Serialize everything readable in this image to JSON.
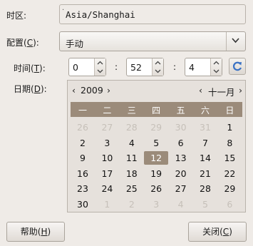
{
  "timezone": {
    "label": "时区:",
    "value": "Asia/Shanghai"
  },
  "config": {
    "label_main": "配置(",
    "label_key": "C",
    "label_end": "):",
    "value": "手动"
  },
  "time": {
    "label_main": "时间(",
    "label_key": "T",
    "label_end": "):",
    "hour": "0",
    "minute": "52",
    "second": "4",
    "separator": ":"
  },
  "date": {
    "label_main": "日期(",
    "label_key": "D",
    "label_end": "):"
  },
  "calendar": {
    "prev_year": "‹",
    "year": "2009",
    "next_year": "›",
    "prev_month": "‹",
    "month": "十一月",
    "next_month": "›",
    "weekdays": [
      "一",
      "二",
      "三",
      "四",
      "五",
      "六",
      "日"
    ],
    "weeks": [
      [
        "26",
        "27",
        "28",
        "29",
        "30",
        "31",
        "1"
      ],
      [
        "2",
        "3",
        "4",
        "5",
        "6",
        "7",
        "8"
      ],
      [
        "9",
        "10",
        "11",
        "12",
        "13",
        "14",
        "15"
      ],
      [
        "16",
        "17",
        "18",
        "19",
        "20",
        "21",
        "22"
      ],
      [
        "23",
        "24",
        "25",
        "26",
        "27",
        "28",
        "29"
      ],
      [
        "30",
        "1",
        "2",
        "3",
        "4",
        "5",
        "6"
      ]
    ],
    "selected": "12"
  },
  "buttons": {
    "help_main": "帮助(",
    "help_key": "H",
    "help_end": ")",
    "close_main": "关闭(",
    "close_key": "C",
    "close_end": ")"
  },
  "colors": {
    "accent": "#9b8b7a",
    "refresh_icon": "#3a72c4"
  }
}
